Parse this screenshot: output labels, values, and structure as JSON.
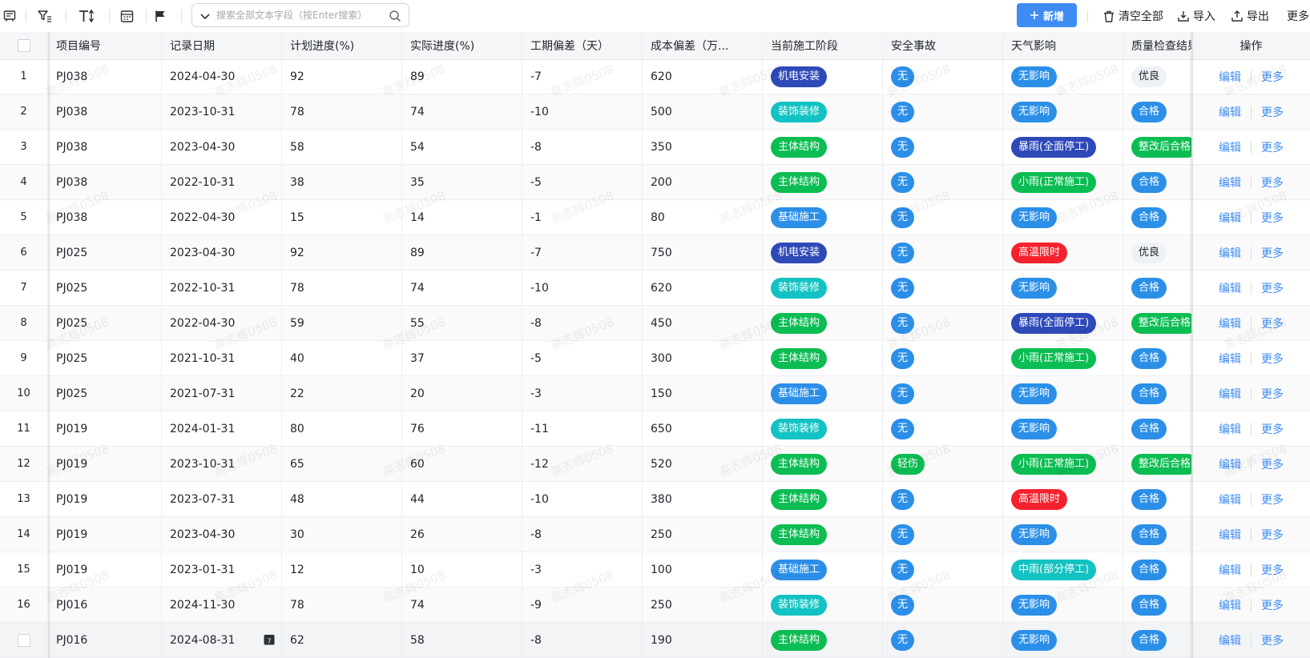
{
  "toolbar": {
    "search_placeholder": "搜索全部文本字段（按Enter搜索）",
    "new_label": "新增",
    "clear_label": "清空全部",
    "import_label": "导入",
    "export_label": "导出",
    "more_label": "更多"
  },
  "columns": [
    "项目编号",
    "记录日期",
    "计划进度(%)",
    "实际进度(%)",
    "工期偏差（天）",
    "成本偏差（万...",
    "当前施工阶段",
    "安全事故",
    "天气影响",
    "质量检查结果",
    "操作"
  ],
  "actions": {
    "edit": "编辑",
    "more": "更多"
  },
  "watermark": "高志辉0508",
  "colors": {
    "accent": "#3e8cf2",
    "stage": {
      "机电安装": "#2e49b8",
      "装饰装修": "#13c2c2",
      "主体结构": "#0bbd52",
      "基础施工": "#2b8fe8"
    },
    "safety": {
      "无": "#2b8fe8",
      "轻伤": "#0bbd52"
    },
    "weather": {
      "无影响": "#2b8fe8",
      "暴雨(全面停工)": "#2e49b8",
      "小雨(正常施工)": "#0bbd52",
      "高温限时": "#f5222d",
      "中雨(部分停工)": "#13c2c2"
    },
    "quality": {
      "优良": "#eef1f6",
      "合格": "#2b8fe8",
      "整改后合格": "#0bbd52"
    }
  },
  "rows": [
    {
      "index": "1",
      "project": "PJ038",
      "date": "2024-04-30",
      "plan": "92",
      "actual": "89",
      "delay": "-7",
      "cost": "620",
      "stage": "机电安装",
      "safety": "无",
      "weather": "无影响",
      "quality": "优良"
    },
    {
      "index": "2",
      "project": "PJ038",
      "date": "2023-10-31",
      "plan": "78",
      "actual": "74",
      "delay": "-10",
      "cost": "500",
      "stage": "装饰装修",
      "safety": "无",
      "weather": "无影响",
      "quality": "合格"
    },
    {
      "index": "3",
      "project": "PJ038",
      "date": "2023-04-30",
      "plan": "58",
      "actual": "54",
      "delay": "-8",
      "cost": "350",
      "stage": "主体结构",
      "safety": "无",
      "weather": "暴雨(全面停工)",
      "quality": "整改后合格"
    },
    {
      "index": "4",
      "project": "PJ038",
      "date": "2022-10-31",
      "plan": "38",
      "actual": "35",
      "delay": "-5",
      "cost": "200",
      "stage": "主体结构",
      "safety": "无",
      "weather": "小雨(正常施工)",
      "quality": "合格"
    },
    {
      "index": "5",
      "project": "PJ038",
      "date": "2022-04-30",
      "plan": "15",
      "actual": "14",
      "delay": "-1",
      "cost": "80",
      "stage": "基础施工",
      "safety": "无",
      "weather": "无影响",
      "quality": "合格"
    },
    {
      "index": "6",
      "project": "PJ025",
      "date": "2023-04-30",
      "plan": "92",
      "actual": "89",
      "delay": "-7",
      "cost": "750",
      "stage": "机电安装",
      "safety": "无",
      "weather": "高温限时",
      "quality": "优良"
    },
    {
      "index": "7",
      "project": "PJ025",
      "date": "2022-10-31",
      "plan": "78",
      "actual": "74",
      "delay": "-10",
      "cost": "620",
      "stage": "装饰装修",
      "safety": "无",
      "weather": "无影响",
      "quality": "合格"
    },
    {
      "index": "8",
      "project": "PJ025",
      "date": "2022-04-30",
      "plan": "59",
      "actual": "55",
      "delay": "-8",
      "cost": "450",
      "stage": "主体结构",
      "safety": "无",
      "weather": "暴雨(全面停工)",
      "quality": "整改后合格"
    },
    {
      "index": "9",
      "project": "PJ025",
      "date": "2021-10-31",
      "plan": "40",
      "actual": "37",
      "delay": "-5",
      "cost": "300",
      "stage": "主体结构",
      "safety": "无",
      "weather": "小雨(正常施工)",
      "quality": "合格"
    },
    {
      "index": "10",
      "project": "PJ025",
      "date": "2021-07-31",
      "plan": "22",
      "actual": "20",
      "delay": "-3",
      "cost": "150",
      "stage": "基础施工",
      "safety": "无",
      "weather": "无影响",
      "quality": "合格"
    },
    {
      "index": "11",
      "project": "PJ019",
      "date": "2024-01-31",
      "plan": "80",
      "actual": "76",
      "delay": "-11",
      "cost": "650",
      "stage": "装饰装修",
      "safety": "无",
      "weather": "无影响",
      "quality": "合格"
    },
    {
      "index": "12",
      "project": "PJ019",
      "date": "2023-10-31",
      "plan": "65",
      "actual": "60",
      "delay": "-12",
      "cost": "520",
      "stage": "主体结构",
      "safety": "轻伤",
      "weather": "小雨(正常施工)",
      "quality": "整改后合格"
    },
    {
      "index": "13",
      "project": "PJ019",
      "date": "2023-07-31",
      "plan": "48",
      "actual": "44",
      "delay": "-10",
      "cost": "380",
      "stage": "主体结构",
      "safety": "无",
      "weather": "高温限时",
      "quality": "合格"
    },
    {
      "index": "14",
      "project": "PJ019",
      "date": "2023-04-30",
      "plan": "30",
      "actual": "26",
      "delay": "-8",
      "cost": "250",
      "stage": "主体结构",
      "safety": "无",
      "weather": "无影响",
      "quality": "合格"
    },
    {
      "index": "15",
      "project": "PJ019",
      "date": "2023-01-31",
      "plan": "12",
      "actual": "10",
      "delay": "-3",
      "cost": "100",
      "stage": "基础施工",
      "safety": "无",
      "weather": "中雨(部分停工)",
      "quality": "合格"
    },
    {
      "index": "16",
      "project": "PJ016",
      "date": "2024-11-30",
      "plan": "78",
      "actual": "74",
      "delay": "-9",
      "cost": "250",
      "stage": "装饰装修",
      "safety": "无",
      "weather": "无影响",
      "quality": "合格"
    },
    {
      "index": "",
      "project": "PJ016",
      "date": "2024-08-31",
      "plan": "62",
      "actual": "58",
      "delay": "-8",
      "cost": "190",
      "stage": "主体结构",
      "safety": "无",
      "weather": "无影响",
      "quality": "合格"
    }
  ]
}
